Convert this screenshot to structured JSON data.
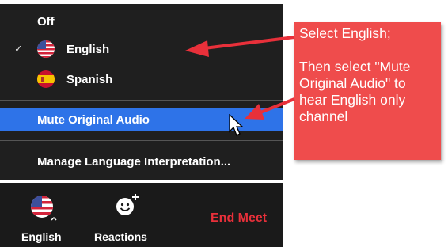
{
  "menu": {
    "items": [
      {
        "label": "Off",
        "checked": false
      },
      {
        "label": "English",
        "checked": true,
        "flag": "us-flag-icon"
      },
      {
        "label": "Spanish",
        "checked": false,
        "flag": "spain-flag-icon"
      }
    ],
    "mute_original": "Mute Original Audio",
    "manage": "Manage Language Interpretation..."
  },
  "toolbar": {
    "language_label": "English",
    "reactions_label": "Reactions",
    "end_meeting_partial": "End Meet"
  },
  "callout": {
    "line1": "Select English;",
    "line2": "Then select \"Mute Original Audio\" to hear English only channel"
  },
  "colors": {
    "menu_bg": "#1f1f1f",
    "highlight": "#2e73e8",
    "callout_bg": "#ef4c4c",
    "arrow": "#e8303a",
    "end_meeting": "#e8303a"
  }
}
